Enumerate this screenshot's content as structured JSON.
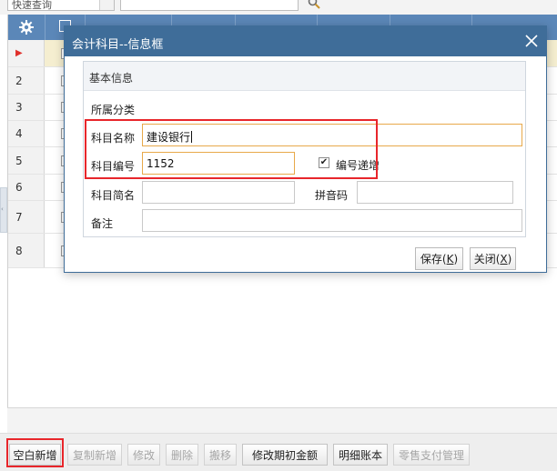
{
  "topbar": {
    "quick_select_value": "快速查询"
  },
  "grid": {
    "rows": [
      {
        "num": ""
      },
      {
        "num": "2"
      },
      {
        "num": "3"
      },
      {
        "num": "4"
      },
      {
        "num": "5"
      },
      {
        "num": "6"
      },
      {
        "num": "7"
      },
      {
        "num": "8"
      }
    ]
  },
  "dialog": {
    "title": "会计科目--信息框",
    "group_title": "基本信息",
    "category_label": "所属分类",
    "name_label": "科目名称",
    "name_value": "建设银行",
    "code_label": "科目编号",
    "code_value": "1152",
    "auto_increment_label": "编号递增",
    "auto_increment_checked": true,
    "short_name_label": "科目简名",
    "short_name_value": "",
    "pinyin_label": "拼音码",
    "pinyin_value": "",
    "remark_label": "备注",
    "remark_value": "",
    "save_label": "保存(",
    "save_key": "K",
    "close_label": "关闭(",
    "close_key": "X",
    "paren_close": ")"
  },
  "toolbar": {
    "new_blank": "空白新增",
    "copy_new": "复制新增",
    "edit": "修改",
    "delete": "删除",
    "move": "搬移",
    "edit_opening": "修改期初金额",
    "detail_ledger": "明细账本",
    "retail_payment": "零售支付管理"
  },
  "colors": {
    "title_bar": "#3f6d99",
    "grid_header": "#5b87b8",
    "highlight_red": "#e8262b",
    "focus_orange": "#e8a94a",
    "selected_row": "#f5eed0"
  },
  "icons": [
    "gear-icon",
    "search-icon",
    "close-icon",
    "checkbox-icon",
    "row-pointer-icon"
  ]
}
